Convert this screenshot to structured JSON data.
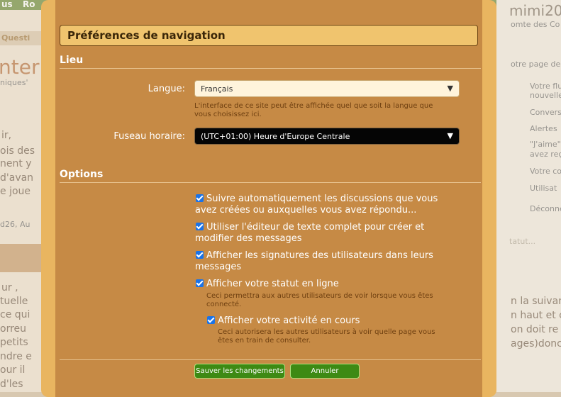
{
  "background": {
    "nav_items": [
      "us",
      "Ro"
    ],
    "breadcrumb_fragment": "Questi",
    "heading_fragment": "nter",
    "sub_fragment": "niques'",
    "para_fragments": [
      "ir,",
      "ois des",
      "nent y",
      "d'avan",
      "e joue"
    ],
    "byline_fragment": "d26, Au",
    "lower_fragments": [
      "ur ,",
      "tuelle",
      "ce qui",
      "orreu",
      "petits",
      "ndre e",
      "our il",
      "d'les"
    ],
    "user_title": "mimi20",
    "user_sub": "omte des Co",
    "account_link": "otre page de",
    "menu_items": [
      "Votre flu",
      "nouvelle",
      "Convers",
      "Alertes",
      "\"J'aime\"",
      "avez reç",
      "Votre co",
      "Utilisat",
      "Déconne"
    ],
    "status_placeholder": "tatut...",
    "right_fragments": [
      "n la suivan",
      "n haut et c",
      "on doit re",
      "ages)donc"
    ]
  },
  "modal": {
    "title": "Préférences de navigation",
    "sections": {
      "lieu": "Lieu",
      "options": "Options"
    },
    "language": {
      "label": "Langue:",
      "value": "Français",
      "hint_line1": "L'interface de ce site peut être affichée quel que soit la langue que",
      "hint_line2": "vous choisissez ici."
    },
    "timezone": {
      "label": "Fuseau horaire:",
      "value": "(UTC+01:00) Heure d'Europe Centrale"
    },
    "options": [
      {
        "checked": true,
        "line1": "Suivre automatiquement les discussions que vous",
        "line2": "avez créées ou auxquelles vous avez répondu..."
      },
      {
        "checked": true,
        "line1": "Utiliser l'éditeur de texte complet pour créer et",
        "line2": "modifier des messages"
      },
      {
        "checked": true,
        "line1": "Afficher les signatures des utilisateurs dans leurs",
        "line2": "messages"
      },
      {
        "checked": true,
        "line1": "Afficher votre statut en ligne",
        "hint1": "Ceci permettra aux autres utilisateurs de voir lorsque vous êtes",
        "hint2": "connecté."
      },
      {
        "checked": true,
        "line1": "Afficher votre activité en cours",
        "hint1": "Ceci autorisera les autres utilisateurs à voir quelle page vous",
        "hint2": "êtes en train de consulter."
      }
    ],
    "buttons": {
      "save": "Sauver les changements",
      "cancel": "Annuler"
    }
  },
  "colors": {
    "modal_frame": "#e9b560",
    "modal_body": "#c68a45",
    "button_green": "#3d8a14",
    "checkbox_blue": "#1a73e8"
  }
}
